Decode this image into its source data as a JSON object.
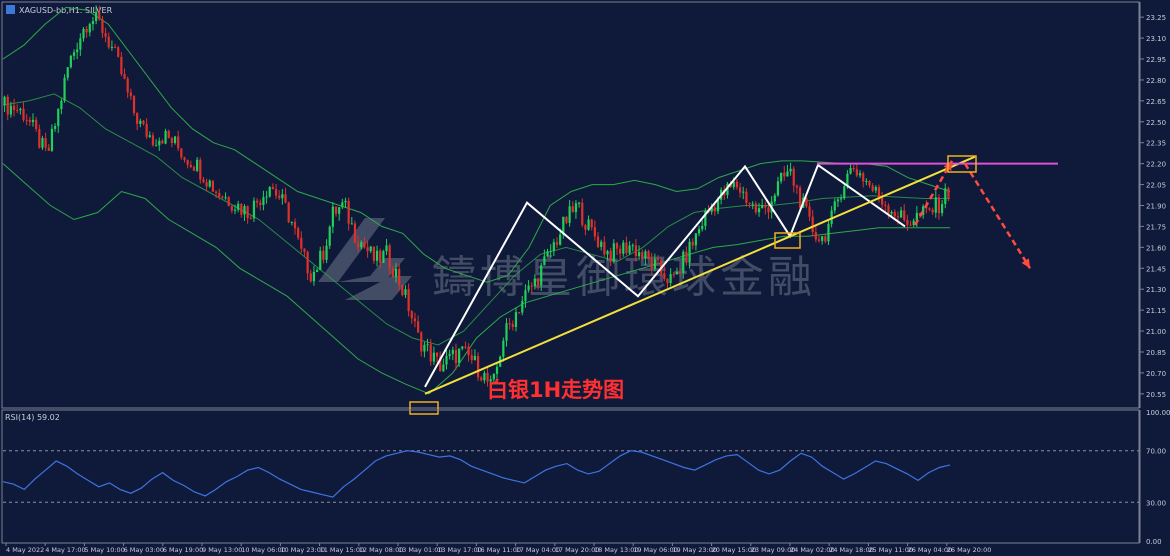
{
  "window": {
    "symbol_title": "XAGUSD-bb,H1: SILVER"
  },
  "annotation": {
    "text": "白银1H走势图"
  },
  "watermark": {
    "text": "鑄博皇御環球金融"
  },
  "colors": {
    "background": "#0f1a3a",
    "bull_candle": "#1fd05a",
    "bear_candle": "#e0302a",
    "bollinger": "#2fa84a",
    "trendline": "#f3e03a",
    "resistance": "#e04fd6",
    "zigzag": "#ffffff",
    "projection": "#ff4a40",
    "highlight_box": "#f0b020",
    "rsi_line": "#3e73e0",
    "axis_text": "#c8ccd8"
  },
  "chart_data": [
    {
      "type": "line",
      "title": "XAGUSD-bb,H1: SILVER",
      "subtitle": "",
      "xlabel": "",
      "ylabel": "",
      "price_axis_ticks": [
        "23.25",
        "23.10",
        "22.95",
        "22.80",
        "22.65",
        "22.50",
        "22.35",
        "22.20",
        "22.05",
        "21.90",
        "21.75",
        "21.60",
        "21.45",
        "21.30",
        "21.15",
        "21.00",
        "20.85",
        "20.70",
        "20.55"
      ],
      "time_axis_ticks": [
        "4 May 2022",
        "4 May 17:00",
        "5 May 10:00",
        "6 May 03:00",
        "6 May 19:00",
        "9 May 13:00",
        "10 May 06:00",
        "10 May 23:00",
        "11 May 15:00",
        "12 May 08:00",
        "13 May 01:00",
        "13 May 17:00",
        "16 May 11:00",
        "17 May 04:00",
        "17 May 20:00",
        "18 May 13:00",
        "19 May 06:00",
        "19 May 23:00",
        "20 May 15:00",
        "23 May 09:00",
        "24 May 02:00",
        "24 May 18:00",
        "25 May 11:00",
        "26 May 04:00",
        "26 May 20:00"
      ],
      "ylim": [
        20.47,
        23.33
      ],
      "grid": false,
      "series": [
        {
          "price_path": [
            22.62,
            22.6,
            22.55,
            22.4,
            22.25,
            22.55,
            22.9,
            23.1,
            23.25,
            23.2,
            23.05,
            22.85,
            22.6,
            22.45,
            22.38,
            22.4,
            22.35,
            22.25,
            22.2,
            22.1,
            22.0,
            21.95,
            21.9,
            21.85,
            21.95,
            22.05,
            21.95,
            21.8,
            21.55,
            21.4,
            21.55,
            21.85,
            21.9,
            21.7,
            21.6,
            21.5,
            21.55,
            21.4,
            21.2,
            20.95,
            20.85,
            20.75,
            20.8,
            20.85,
            20.8,
            20.7,
            20.58,
            20.95,
            21.1,
            21.25,
            21.35,
            21.5,
            21.65,
            21.8,
            21.9,
            21.75,
            21.65,
            21.55,
            21.58,
            21.62,
            21.55,
            21.48,
            21.42,
            21.35,
            21.5,
            21.65,
            21.82,
            21.92,
            22.0,
            22.05,
            21.95,
            21.85,
            21.9,
            22.05,
            22.15,
            21.95,
            21.75,
            21.65,
            21.8,
            22.05,
            22.18,
            22.1,
            22.0,
            21.92,
            21.85,
            21.78,
            21.82,
            21.85,
            21.9,
            22.0
          ],
          "bb_upper": [
            22.95,
            23.05,
            23.2,
            23.32,
            23.3,
            23.2,
            23.0,
            22.8,
            22.6,
            22.45,
            22.35,
            22.3,
            22.2,
            22.1,
            22.0,
            21.95,
            21.9,
            21.85,
            21.75,
            21.7,
            21.55,
            21.45,
            21.4,
            21.35,
            21.4,
            21.6,
            21.9,
            22.0,
            22.05,
            22.05,
            22.08,
            22.05,
            22.0,
            22.02,
            22.1,
            22.15,
            22.2,
            22.22,
            22.22,
            22.21,
            22.2,
            22.2,
            22.18,
            22.1,
            22.05,
            22.0
          ],
          "bb_lower": [
            22.2,
            22.05,
            21.9,
            21.8,
            21.85,
            22.0,
            21.95,
            21.8,
            21.7,
            21.6,
            21.45,
            21.35,
            21.25,
            21.1,
            20.95,
            20.8,
            20.7,
            20.62,
            20.55,
            20.7,
            20.95,
            21.1,
            21.2,
            21.25,
            21.3,
            21.35,
            21.4,
            21.45,
            21.5,
            21.55,
            21.6,
            21.62,
            21.65,
            21.68,
            21.68,
            21.7,
            21.72,
            21.74,
            21.74,
            21.74,
            21.74
          ],
          "bb_middle": [
            22.62,
            22.65,
            22.7,
            22.6,
            22.45,
            22.35,
            22.25,
            22.1,
            22.0,
            21.9,
            21.8,
            21.65,
            21.5,
            21.35,
            21.2,
            21.05,
            20.95,
            20.9,
            21.0,
            21.2,
            21.4,
            21.55,
            21.6,
            21.55,
            21.5,
            21.6,
            21.75,
            21.85,
            21.88,
            21.9,
            21.9,
            21.92,
            21.95,
            21.96,
            21.97,
            21.96,
            21.95,
            21.95
          ]
        }
      ],
      "zigzag": [
        [
          20.6,
          21.92
        ],
        [
          21.25,
          22.18
        ],
        [
          21.68,
          22.19
        ],
        [
          21.75,
          21.9
        ]
      ],
      "trendline": [
        20.55,
        22.25
      ],
      "resistance_level": 22.2,
      "projection": [
        [
          21.76,
          22.22
        ],
        [
          22.2,
          21.45
        ]
      ]
    },
    {
      "type": "line",
      "title": "RSI(14) 59.02",
      "subtitle": "",
      "xlabel": "",
      "ylabel": "",
      "ylim": [
        0,
        100
      ],
      "axis_ticks": [
        "100.00",
        "70.00",
        "30.00",
        "0.00"
      ],
      "levels": [
        70,
        30
      ],
      "grid": false,
      "series": [
        {
          "name": "RSI(14)",
          "values": [
            46,
            44,
            40,
            48,
            55,
            62,
            58,
            52,
            47,
            42,
            45,
            40,
            37,
            41,
            48,
            53,
            47,
            43,
            38,
            35,
            40,
            46,
            50,
            55,
            57,
            53,
            48,
            44,
            40,
            38,
            36,
            34,
            42,
            48,
            55,
            62,
            66,
            68,
            70,
            69,
            67,
            65,
            66,
            63,
            58,
            55,
            52,
            49,
            47,
            45,
            50,
            55,
            58,
            60,
            55,
            52,
            54,
            60,
            66,
            70,
            69,
            66,
            63,
            60,
            57,
            55,
            59,
            63,
            66,
            67,
            61,
            55,
            52,
            55,
            62,
            68,
            65,
            58,
            53,
            48,
            52,
            57,
            62,
            60,
            56,
            52,
            47,
            53,
            57,
            59
          ]
        }
      ]
    }
  ]
}
